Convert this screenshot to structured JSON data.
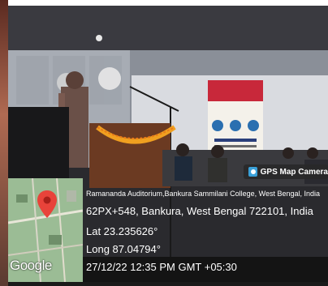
{
  "overlay": {
    "gps_badge": "GPS Map Camera",
    "address_line1": "Ramananda Auditorium,Bankura Sammilani College, West Bengal, India",
    "address_line2": "62PX+548, Bankura, West Bengal 722101, India",
    "latitude": "Lat 23.235626°",
    "longitude": "Long 87.04794°",
    "datetime": "27/12/22 12:35 PM GMT +05:30",
    "map_logo": "Google",
    "pin_icon": "map-pin-icon",
    "pin_color": "#e8433a"
  }
}
